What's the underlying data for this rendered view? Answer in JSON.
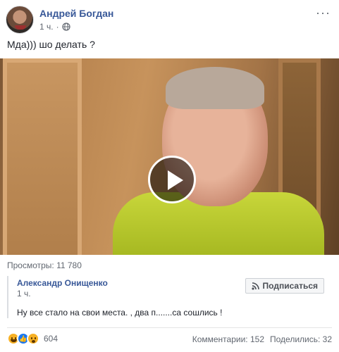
{
  "post": {
    "author": "Андрей Богдан",
    "time": "1 ч.",
    "privacy_icon": "globe-icon",
    "more_icon": "more-icon",
    "text": "Мда))) шо делать ?"
  },
  "video": {
    "play_icon": "play-icon",
    "views": "Просмотры: 11 780"
  },
  "shared": {
    "author": "Александр Онищенко",
    "time": "1 ч.",
    "subscribe_label": "Подписаться",
    "text": "Ну все стало на свои места. , два п.......са сошлись !"
  },
  "footer": {
    "reactions": [
      "haha",
      "like",
      "wow"
    ],
    "reaction_count": "604",
    "comments": "Комментарии: 152",
    "shares": "Поделились: 32"
  },
  "colors": {
    "link": "#385898",
    "secondary_text": "#616770",
    "like_blue": "#1877f2",
    "emoji_yellow": "#f7b125"
  }
}
